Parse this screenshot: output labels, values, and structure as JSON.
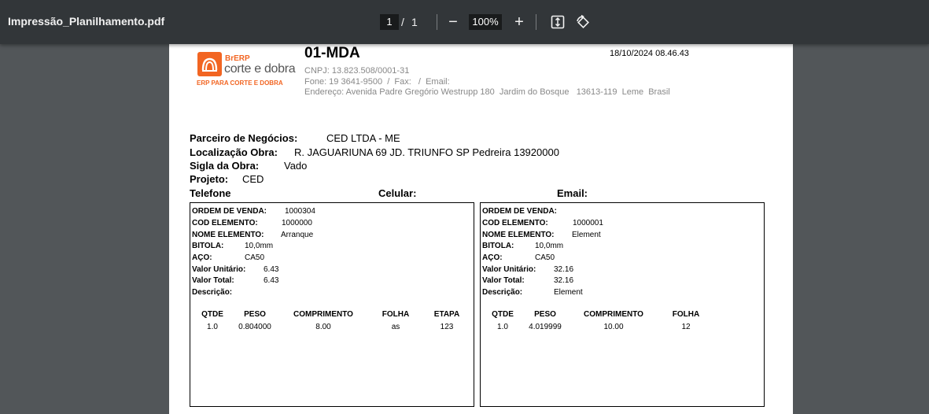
{
  "viewer": {
    "file_name": "Impressão_Planilhamento.pdf",
    "page_current": "1",
    "page_separator": "/",
    "page_total": "1",
    "zoom_minus": "−",
    "zoom": "100%",
    "zoom_plus": "+"
  },
  "icons": [
    "zoom-out-icon",
    "zoom-in-icon",
    "fit-page-icon",
    "rotate-icon"
  ],
  "header": {
    "logo_brand": "BrERP",
    "logo_main": "corte e dobra",
    "logo_tagline": "ERP PARA CORTE E DOBRA",
    "doc_code": "01-MDA",
    "datetime": "18/10/2024 08.46.43",
    "cnpj": "CNPJ: 13.823.508/0001-31",
    "contact": "Fone: 19 3641-9500  /  Fax:   /  Email:",
    "address": "Endereço: Avenida Padre Gregório Westrupp 180  Jardim do Bosque   13613-119  Leme  Brasil"
  },
  "info": {
    "partner_label": "Parceiro de Negócios:",
    "partner_value": "CED LTDA - ME",
    "location_label": "Localização Obra:",
    "location_value": "R. JAGUARIUNA 69 JD. TRIUNFO SP Pedreira 13920000",
    "site_label": "Sigla da Obra:",
    "site_value": "Vado",
    "project_label": "Projeto:",
    "project_value": "CED",
    "phone_label": "Telefone",
    "mobile_label": "Celular:",
    "email_label": "Email:"
  },
  "fields": {
    "order": "ORDEM DE VENDA:",
    "code": "COD ELEMENTO:",
    "name": "NOME ELEMENTO:",
    "gauge": "BITOLA:",
    "steel": "AÇO:",
    "unit": "Valor Unitário:",
    "total": "Valor Total:",
    "desc": "Descrição:"
  },
  "columns": {
    "qty": "QTDE",
    "weight": "PESO",
    "length": "COMPRIMENTO",
    "sheet": "FOLHA",
    "stage": "ETAPA"
  },
  "cards": [
    {
      "order": "1000304",
      "code": "1000000",
      "name": "Arranque",
      "gauge": "10,0mm",
      "steel": "CA50",
      "unit": "6.43",
      "total": "6.43",
      "desc": "",
      "row": {
        "qty": "1.0",
        "weight": "0.804000",
        "length": "8.00",
        "sheet": "as",
        "stage": "123"
      }
    },
    {
      "order": "",
      "code": "1000001",
      "name": "Element",
      "gauge": "10,0mm",
      "steel": "CA50",
      "unit": "32.16",
      "total": "32.16",
      "desc": "Element",
      "row": {
        "qty": "1.0",
        "weight": "4.019999",
        "length": "10.00",
        "sheet": "12",
        "stage": ""
      }
    }
  ]
}
